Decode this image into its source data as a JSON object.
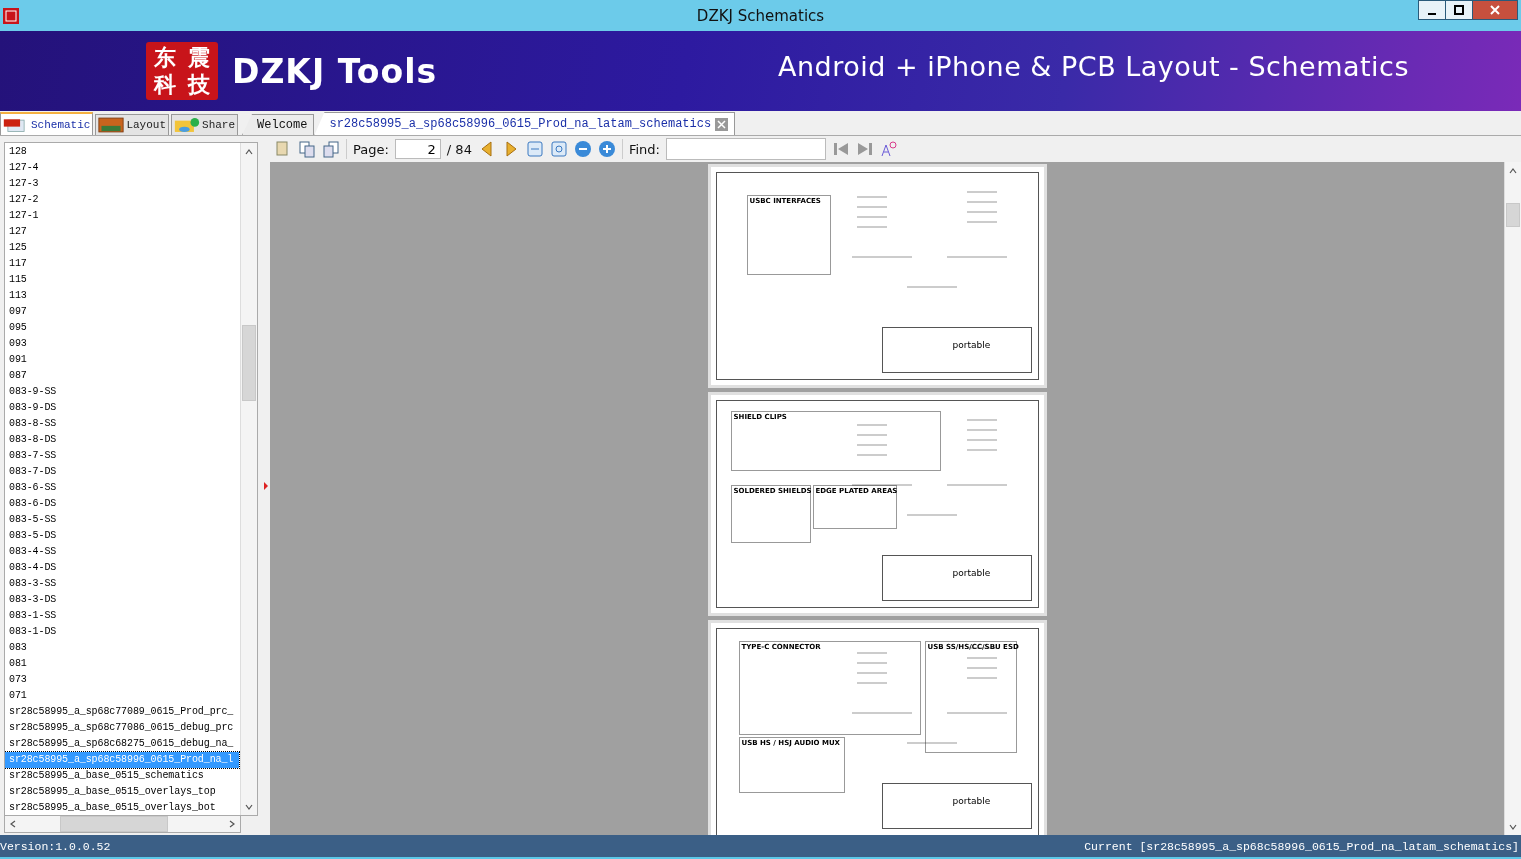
{
  "window": {
    "title": "DZKJ Schematics"
  },
  "banner": {
    "logo_text": "东震科技",
    "brand": "DZKJ Tools",
    "tagline": "Android + iPhone & PCB Layout - Schematics"
  },
  "side_tabs": [
    {
      "label": "Schematic",
      "kind": "pdf",
      "selected": true
    },
    {
      "label": "Layout",
      "kind": "pads",
      "selected": false
    },
    {
      "label": "Share",
      "kind": "share",
      "selected": false
    }
  ],
  "doc_tabs": [
    {
      "label": "Welcome",
      "selected": false
    },
    {
      "label": "sr28c58995_a_sp68c58996_0615_Prod_na_latam_schematics",
      "selected": true
    }
  ],
  "file_list": [
    {
      "label": "128",
      "selected": false
    },
    {
      "label": "127-4",
      "selected": false
    },
    {
      "label": "127-3",
      "selected": false
    },
    {
      "label": "127-2",
      "selected": false
    },
    {
      "label": "127-1",
      "selected": false
    },
    {
      "label": "127",
      "selected": false
    },
    {
      "label": "125",
      "selected": false
    },
    {
      "label": "117",
      "selected": false
    },
    {
      "label": "115",
      "selected": false
    },
    {
      "label": "113",
      "selected": false
    },
    {
      "label": "097",
      "selected": false
    },
    {
      "label": "095",
      "selected": false
    },
    {
      "label": "093",
      "selected": false
    },
    {
      "label": "091",
      "selected": false
    },
    {
      "label": "087",
      "selected": false
    },
    {
      "label": "083-9-SS",
      "selected": false
    },
    {
      "label": "083-9-DS",
      "selected": false
    },
    {
      "label": "083-8-SS",
      "selected": false
    },
    {
      "label": "083-8-DS",
      "selected": false
    },
    {
      "label": "083-7-SS",
      "selected": false
    },
    {
      "label": "083-7-DS",
      "selected": false
    },
    {
      "label": "083-6-SS",
      "selected": false
    },
    {
      "label": "083-6-DS",
      "selected": false
    },
    {
      "label": "083-5-SS",
      "selected": false
    },
    {
      "label": "083-5-DS",
      "selected": false
    },
    {
      "label": "083-4-SS",
      "selected": false
    },
    {
      "label": "083-4-DS",
      "selected": false
    },
    {
      "label": "083-3-SS",
      "selected": false
    },
    {
      "label": "083-3-DS",
      "selected": false
    },
    {
      "label": "083-1-SS",
      "selected": false
    },
    {
      "label": "083-1-DS",
      "selected": false
    },
    {
      "label": "083",
      "selected": false
    },
    {
      "label": "081",
      "selected": false
    },
    {
      "label": "073",
      "selected": false
    },
    {
      "label": "071",
      "selected": false
    },
    {
      "label": "sr28c58995_a_sp68c77089_0615_Prod_prc_",
      "selected": false
    },
    {
      "label": "sr28c58995_a_sp68c77086_0615_debug_prc",
      "selected": false
    },
    {
      "label": "sr28c58995_a_sp68c68275_0615_debug_na_",
      "selected": false
    },
    {
      "label": "sr28c58995_a_sp68c58996_0615_Prod_na_l",
      "selected": true
    },
    {
      "label": "sr28c58995_a_base_0515_schematics",
      "selected": false
    },
    {
      "label": "sr28c58995_a_base_0515_overlays_top",
      "selected": false
    },
    {
      "label": "sr28c58995_a_base_0515_overlays_bot",
      "selected": false
    }
  ],
  "toolbar": {
    "page_label": "Page:",
    "page_value": "2",
    "page_total": "/ 84",
    "find_label": "Find:"
  },
  "pages": [
    {
      "blocks": [
        "USBC INTERFACES"
      ],
      "title_block": "portable"
    },
    {
      "blocks": [
        "SHIELD CLIPS",
        "SOLDERED SHIELDS",
        "EDGE PLATED AREAS"
      ],
      "title_block": "portable"
    },
    {
      "blocks": [
        "TYPE-C CONNECTOR",
        "USB SS/HS/CC/SBU ESD",
        "USB HS / HSJ AUDIO MUX"
      ],
      "title_block": "portable"
    }
  ],
  "status_bar": {
    "version": "Version:1.0.0.52",
    "current": "Current [sr28c58995_a_sp68c58996_0615_Prod_na_latam_schematics]"
  }
}
